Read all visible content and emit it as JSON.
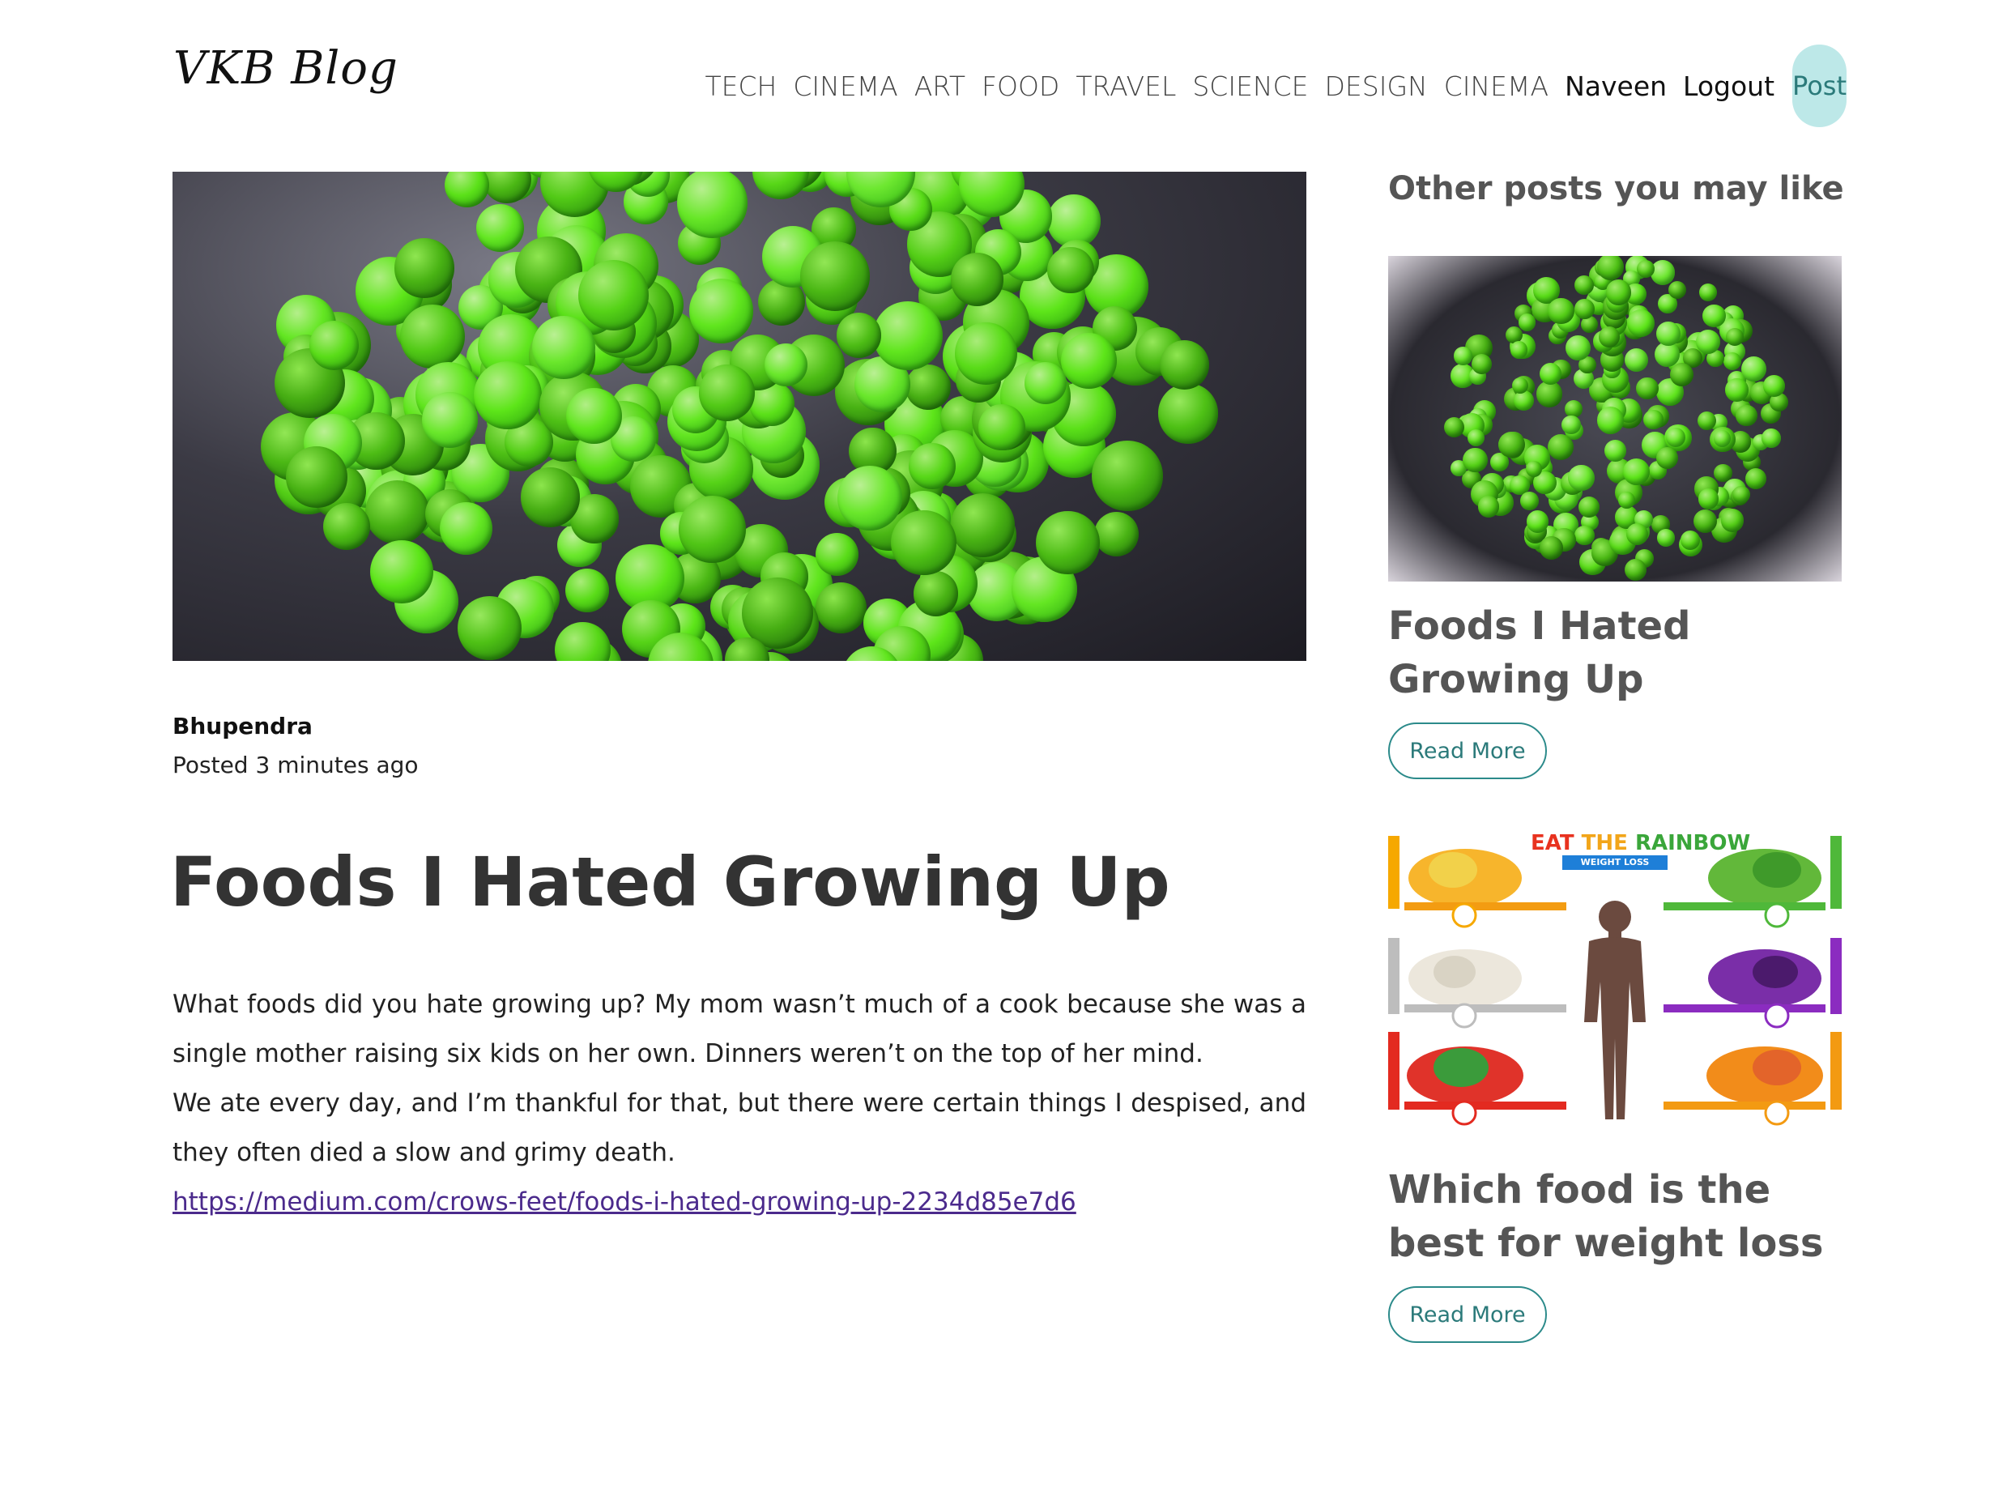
{
  "brand": {
    "name": "VKB Blog"
  },
  "nav": {
    "items": [
      "TECH",
      "CINEMA",
      "ART",
      "FOOD",
      "TRAVEL",
      "SCIENCE",
      "DESIGN",
      "CINEMA"
    ],
    "user": "Naveen",
    "logout": "Logout",
    "post_button": "Post"
  },
  "article": {
    "author": "Bhupendra",
    "posted": "Posted 3 minutes ago",
    "title": "Foods I Hated Growing Up",
    "paragraphs": [
      "What foods did you hate growing up? My mom wasn’t much of a cook because she was a single mother raising six kids on her own. Dinners weren’t on the top of her mind.",
      "We ate every day, and I’m thankful for that, but there were certain things I despised, and they often died a slow and grimy death."
    ],
    "link": "https://medium.com/crows-feet/foods-i-hated-growing-up-2234d85e7d6"
  },
  "sidebar": {
    "heading": "Other posts you may like",
    "posts": [
      {
        "title": "Foods I Hated Growing Up",
        "button": "Read More"
      },
      {
        "title": "Which food is the best for weight loss",
        "button": "Read More"
      }
    ],
    "rainbow_image": {
      "title_parts": [
        "EAT ",
        "THE ",
        "RAINBOW"
      ],
      "subtitle": "WEIGHT LOSS"
    }
  },
  "colors": {
    "accent": "#2b8a8a",
    "post_bubble": "#bde8e8",
    "link": "#4b2a8c",
    "pea_green": "#5cc22a"
  }
}
